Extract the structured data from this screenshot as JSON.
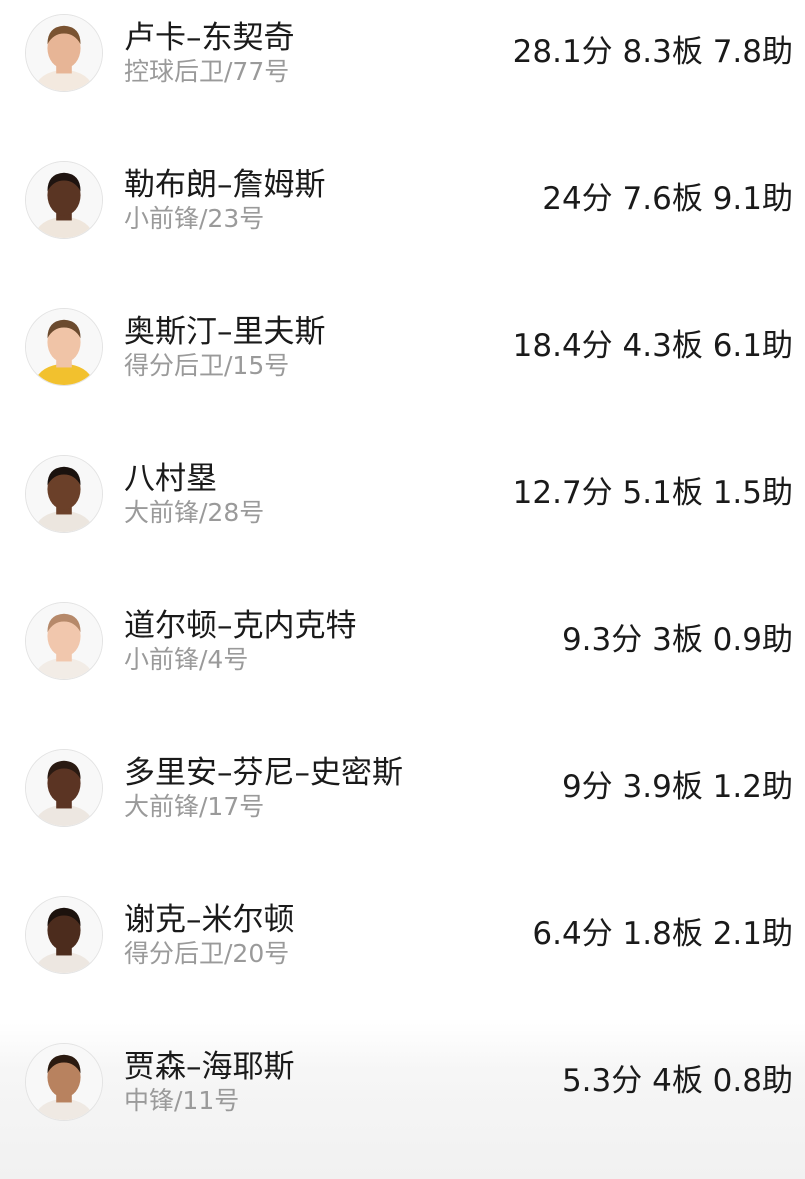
{
  "players": [
    {
      "name": "卢卡–东契奇",
      "position": "控球后卫/77号",
      "stats": "28.1分 8.3板 7.8助",
      "avatar_icon": "player-headshot-icon",
      "skin": "#e7b596",
      "hair": "#7a5331",
      "jersey": "#f3e9df"
    },
    {
      "name": "勒布朗–詹姆斯",
      "position": "小前锋/23号",
      "stats": "24分 7.6板 9.1助",
      "avatar_icon": "player-headshot-icon",
      "skin": "#5a3523",
      "hair": "#1f1410",
      "jersey": "#efe6dc"
    },
    {
      "name": "奥斯汀–里夫斯",
      "position": "得分后卫/15号",
      "stats": "18.4分 4.3板 6.1助",
      "avatar_icon": "player-headshot-icon",
      "skin": "#f0c4a7",
      "hair": "#6b4a2e",
      "jersey": "#f2c12e"
    },
    {
      "name": "八村塁",
      "position": "大前锋/28号",
      "stats": "12.7分 5.1板 1.5助",
      "avatar_icon": "player-headshot-icon",
      "skin": "#6b4029",
      "hair": "#1a120e",
      "jersey": "#ece6df"
    },
    {
      "name": "道尔顿–克内克特",
      "position": "小前锋/4号",
      "stats": "9.3分 3板 0.9助",
      "avatar_icon": "player-headshot-icon",
      "skin": "#f1c7ad",
      "hair": "#b6896a",
      "jersey": "#f2ece6"
    },
    {
      "name": "多里安–芬尼–史密斯",
      "position": "大前锋/17号",
      "stats": "9分 3.9板 1.2助",
      "avatar_icon": "player-headshot-icon",
      "skin": "#5b3423",
      "hair": "#2a1a12",
      "jersey": "#ede7e1"
    },
    {
      "name": "谢克–米尔顿",
      "position": "得分后卫/20号",
      "stats": "6.4分 1.8板 2.1助",
      "avatar_icon": "player-headshot-icon",
      "skin": "#4c2c1d",
      "hair": "#1c120d",
      "jersey": "#ede7e1"
    },
    {
      "name": "贾森–海耶斯",
      "position": "中锋/11号",
      "stats": "5.3分 4板 0.8助",
      "avatar_icon": "player-headshot-icon",
      "skin": "#b8825f",
      "hair": "#2b1a10",
      "jersey": "#efe9e3"
    }
  ]
}
